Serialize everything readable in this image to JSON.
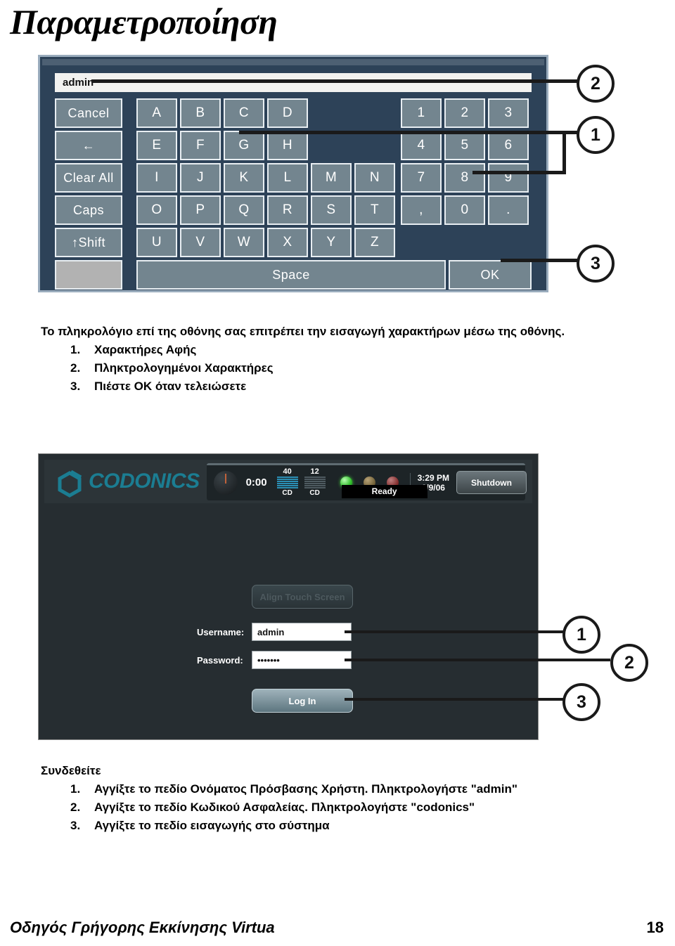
{
  "page": {
    "title": "Παραμετροποίηση",
    "footer_text": "Οδηγός Γρήγορης Εκκίνησης Virtua",
    "footer_page": "18"
  },
  "keyboard_figure": {
    "display_value": "admin",
    "function_keys": [
      "Cancel",
      "←",
      "Clear All",
      "Caps",
      "↑Shift",
      ""
    ],
    "rows": [
      [
        "A",
        "B",
        "C",
        "D"
      ],
      [
        "E",
        "F",
        "G",
        "H"
      ],
      [
        "I",
        "J",
        "K",
        "L",
        "M",
        "N"
      ],
      [
        "O",
        "P",
        "Q",
        "R",
        "S",
        "T"
      ],
      [
        "U",
        "V",
        "W",
        "X",
        "Y",
        "Z"
      ]
    ],
    "numpad_rows": [
      [
        "1",
        "2",
        "3"
      ],
      [
        "4",
        "5",
        "6"
      ],
      [
        "7",
        "8",
        "9"
      ],
      [
        ",",
        "0",
        "."
      ]
    ],
    "space_label": "Space",
    "ok_label": "OK",
    "callouts": [
      "2",
      "1",
      "3"
    ]
  },
  "keyboard_instructions": {
    "intro": "Το πληκρολόγιο επί της οθόνης σας επιτρέπει την εισαγωγή χαρακτήρων μέσω της οθόνης.",
    "items": [
      {
        "num": "1.",
        "text": "Χαρακτήρες Αφής"
      },
      {
        "num": "2.",
        "text": "Πληκτρολογημένοι Χαρακτήρες"
      },
      {
        "num": "3.",
        "text": "Πιέστε ΟΚ όταν τελειώσετε"
      }
    ]
  },
  "login_figure": {
    "brand": "CODONICS",
    "timer": "0:00",
    "meters": [
      {
        "count": "40",
        "label": "CD",
        "filled": true
      },
      {
        "count": "12",
        "label": "CD",
        "filled": false
      }
    ],
    "status": "Ready",
    "time": "3:29 PM",
    "date": "6/9/06",
    "shutdown_label": "Shutdown",
    "align_label": "Align Touch Screen",
    "username_label": "Username:",
    "username_value": "admin",
    "password_label": "Password:",
    "password_value": "•••••••",
    "login_label": "Log In",
    "callouts": [
      "1",
      "2",
      "3"
    ]
  },
  "login_instructions": {
    "heading": "Συνδεθείτε",
    "items": [
      {
        "num": "1.",
        "text": "Αγγίξτε το πεδίο Ονόματος Πρόσβασης Χρήστη. Πληκτρολογήστε \"admin\""
      },
      {
        "num": "2.",
        "text": "Αγγίξτε το πεδίο Κωδικού Ασφαλείας. Πληκτρολογήστε \"codonics\""
      },
      {
        "num": "3.",
        "text": "Αγγίξτε το πεδίο εισαγωγής στο σύστημα"
      }
    ]
  },
  "colors": {
    "keyboard_panel": "#2d4258",
    "key_face": "#73858f",
    "brand_teal": "#1b7d92",
    "screen_bg": "#262d31"
  }
}
